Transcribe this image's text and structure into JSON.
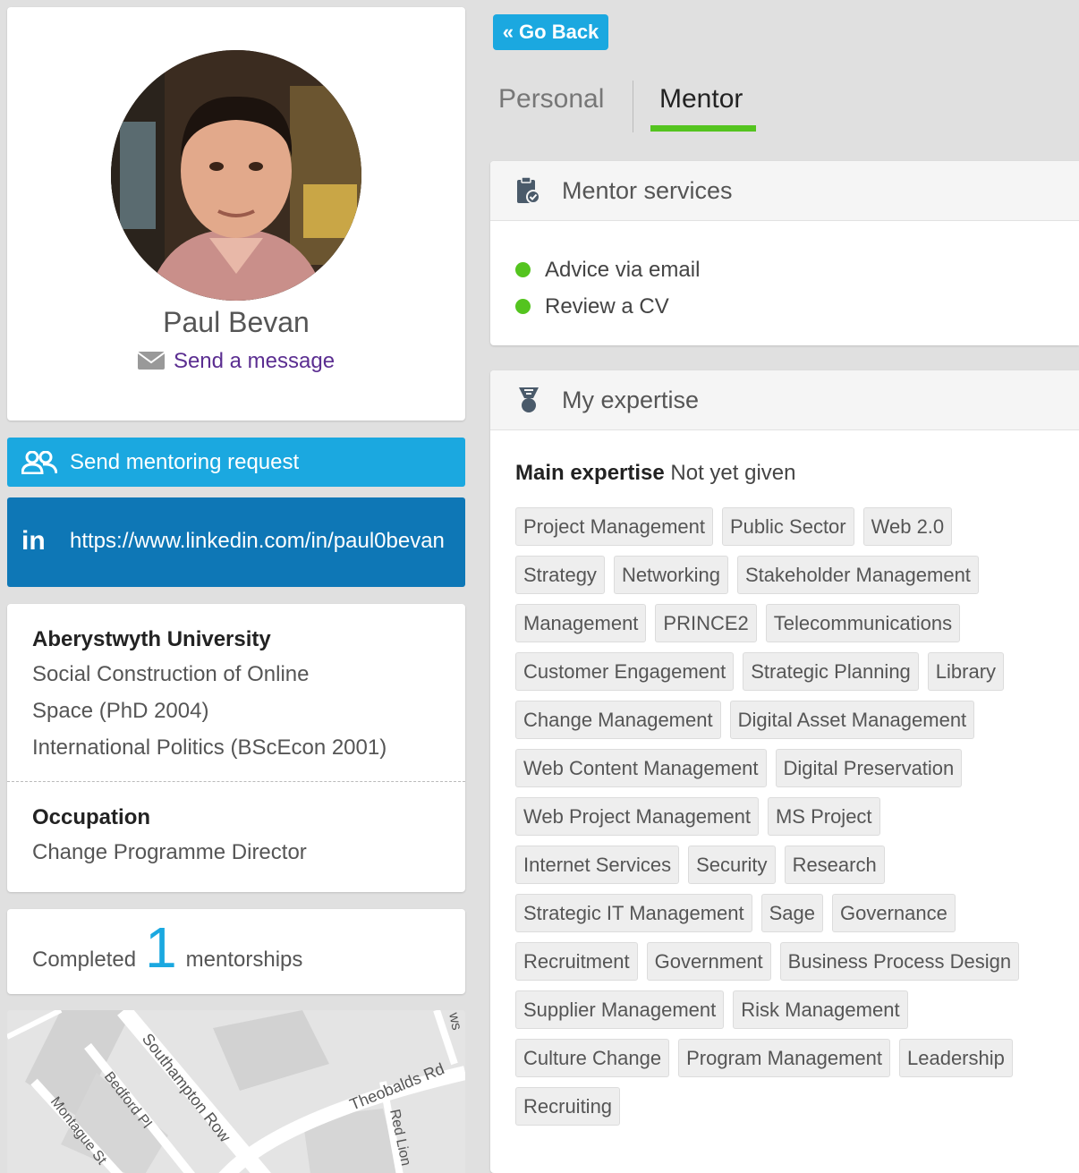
{
  "profile": {
    "name": "Paul Bevan",
    "send_message": "Send a message"
  },
  "actions": {
    "mentoring_request": "Send mentoring request",
    "linkedin_url": "https://www.linkedin.com/in/paul0bevan",
    "linkedin_icon": "in"
  },
  "education": {
    "institution": "Aberystwyth University",
    "degrees": [
      "Social Construction of Online Space   (PhD 2004)",
      "International Politics   (BScEcon 2001)"
    ]
  },
  "occupation": {
    "label": "Occupation",
    "value": "Change Programme Director"
  },
  "mentorships": {
    "prefix": "Completed",
    "count": "1",
    "suffix": "mentorships"
  },
  "map": {
    "labels": [
      "Southampton Row",
      "Bedford Pl",
      "Montague St",
      "Theobalds Rd",
      "Red Lion",
      "ws"
    ]
  },
  "nav": {
    "go_back": "« Go Back",
    "tabs": [
      {
        "label": "Personal",
        "active": false
      },
      {
        "label": "Mentor",
        "active": true
      }
    ]
  },
  "mentor_services": {
    "title": "Mentor services",
    "items": [
      "Advice via email",
      "Review a CV"
    ]
  },
  "expertise": {
    "title": "My expertise",
    "main_label": "Main expertise",
    "main_value": "Not yet given",
    "tags": [
      "Project Management",
      "Public Sector",
      "Web 2.0",
      "Strategy",
      "Networking",
      "Stakeholder Management",
      "Management",
      "PRINCE2",
      "Telecommunications",
      "Customer Engagement",
      "Strategic Planning",
      "Library",
      "Change Management",
      "Digital Asset Management",
      "Web Content Management",
      "Digital Preservation",
      "Web Project Management",
      "MS Project",
      "Internet Services",
      "Security",
      "Research",
      "Strategic IT Management",
      "Sage",
      "Governance",
      "Recruitment",
      "Government",
      "Business Process Design",
      "Supplier Management",
      "Risk Management",
      "Culture Change",
      "Program Management",
      "Leadership",
      "Recruiting"
    ]
  },
  "colors": {
    "primary_blue": "#1ba8e0",
    "linkedin_blue": "#0e77b6",
    "active_green": "#54c41f",
    "link_purple": "#5b2e91"
  }
}
